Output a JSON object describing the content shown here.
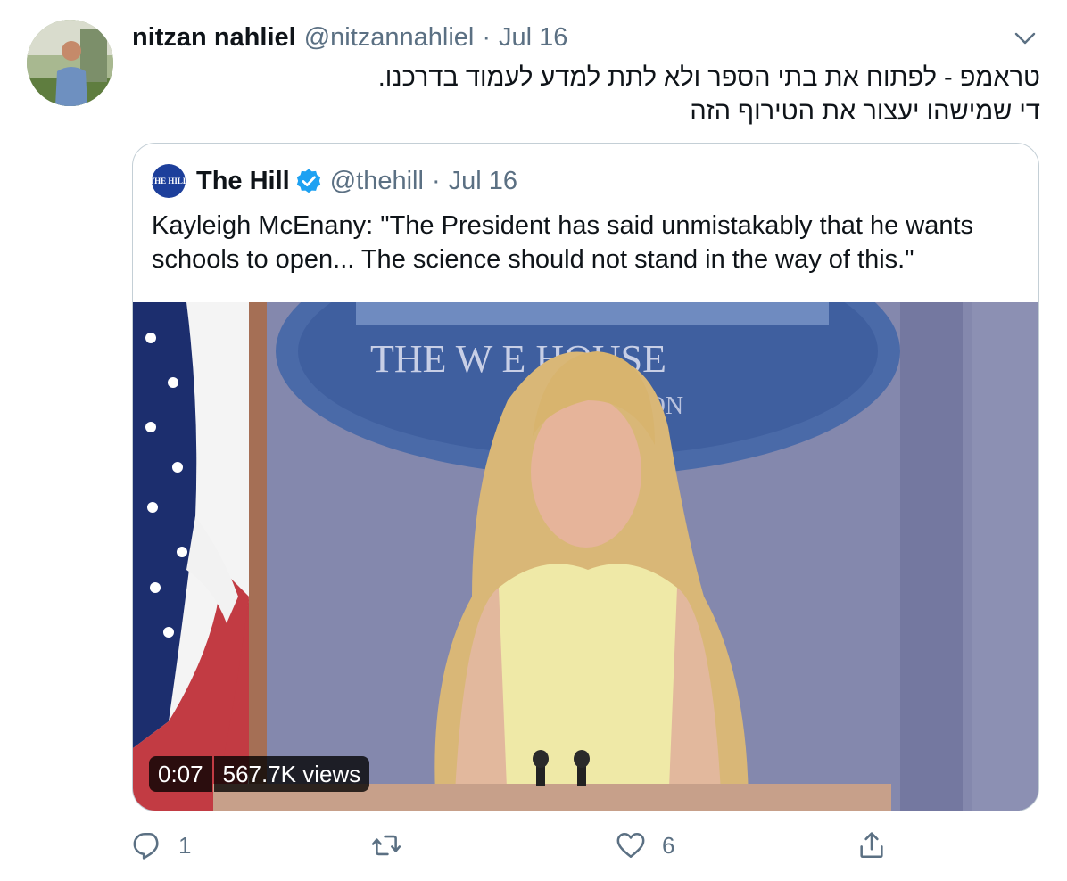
{
  "tweet": {
    "author_name": "nitzan nahliel",
    "author_handle": "@nitzannahliel",
    "separator": "·",
    "date": "Jul 16",
    "text_line1": "טראמפ - לפתוח את בתי הספר ולא לתת למדע לעמוד בדרכנו.",
    "text_line2": "די שמישהו יעצור את הטירוף הזה"
  },
  "quoted_tweet": {
    "logo_text": "THE HILL",
    "author_name": "The Hill",
    "author_handle": "@thehill",
    "separator": "·",
    "date": "Jul 16",
    "text": "Kayleigh McEnany: \"The President has said unmistakably that he wants schools to open... The science should not stand in the way of this.\"",
    "video": {
      "duration": "0:07",
      "views": "567.7K views",
      "backdrop_sign_line1": "THE W    E HOUSE",
      "backdrop_sign_line2": "TON"
    }
  },
  "actions": {
    "reply_count": "1",
    "retweet_count": "",
    "like_count": "6"
  },
  "icons": [
    "chevron-down-icon",
    "verified-badge-icon",
    "reply-icon",
    "retweet-icon",
    "like-icon",
    "share-icon"
  ],
  "colors": {
    "secondary_text": "#5b7083",
    "verified_blue": "#1da1f2",
    "border": "#c4cfd6"
  }
}
